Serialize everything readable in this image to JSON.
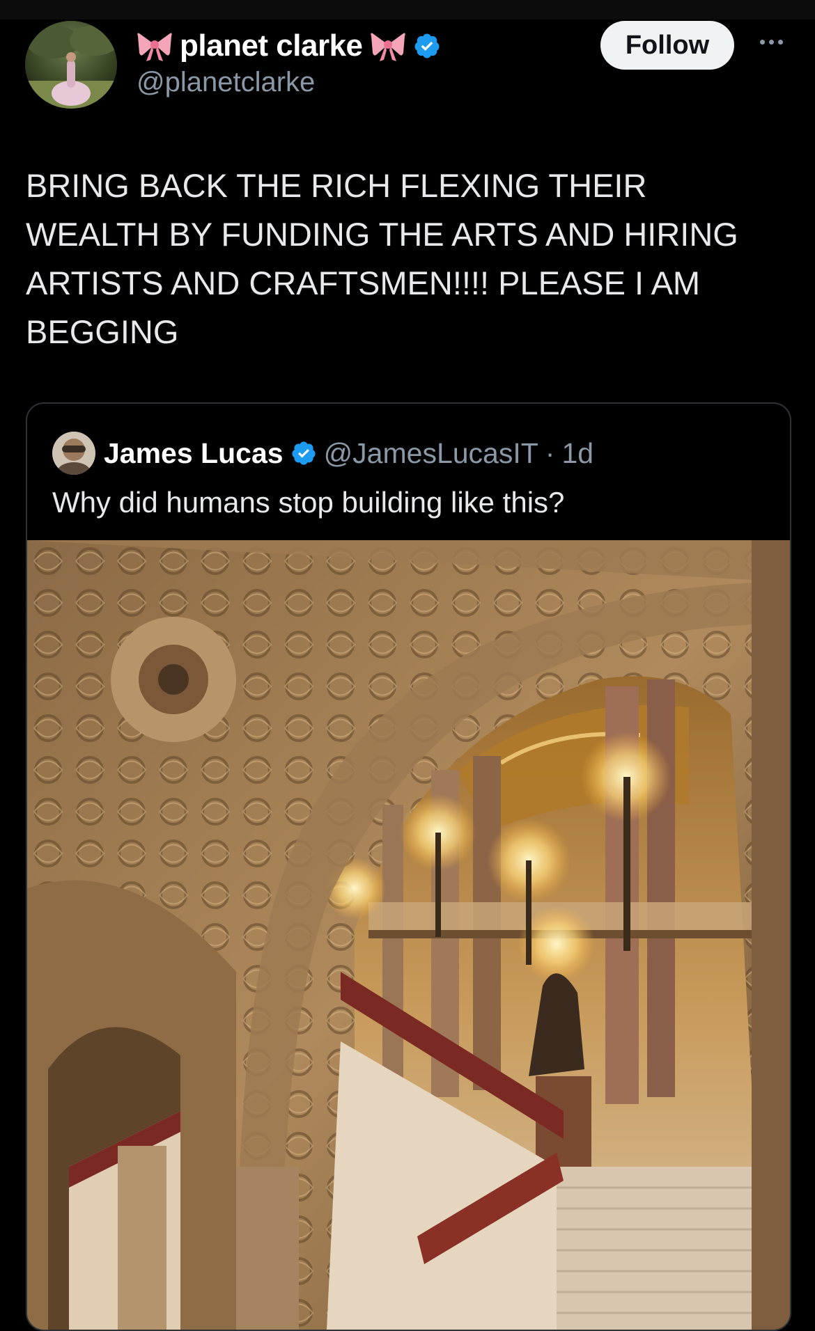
{
  "author": {
    "display_name": "planet clarke",
    "handle": "@planetclarke",
    "verified": true,
    "emoji_left": "🎀",
    "emoji_right": "🎀"
  },
  "actions": {
    "follow_label": "Follow",
    "more_icon": "more-horizontal-icon"
  },
  "tweet": {
    "lines": [
      "BRING BACK THE RICH FLEXING THEIR",
      "WEALTH BY FUNDING THE ARTS AND HIRING",
      "ARTISTS AND CRAFTSMEN!!!! PLEASE I AM",
      "BEGGING"
    ]
  },
  "quoted": {
    "display_name": "James Lucas",
    "handle": "@JamesLucasIT",
    "separator": "·",
    "time": "1d",
    "verified": true,
    "text": "Why did humans stop building like this?"
  },
  "colors": {
    "background": "#000000",
    "text": "#e7e9ea",
    "secondary": "#8b98a5",
    "verified": "#1d9bf0",
    "bow": "#f4a6b8",
    "border": "#2f3336"
  }
}
